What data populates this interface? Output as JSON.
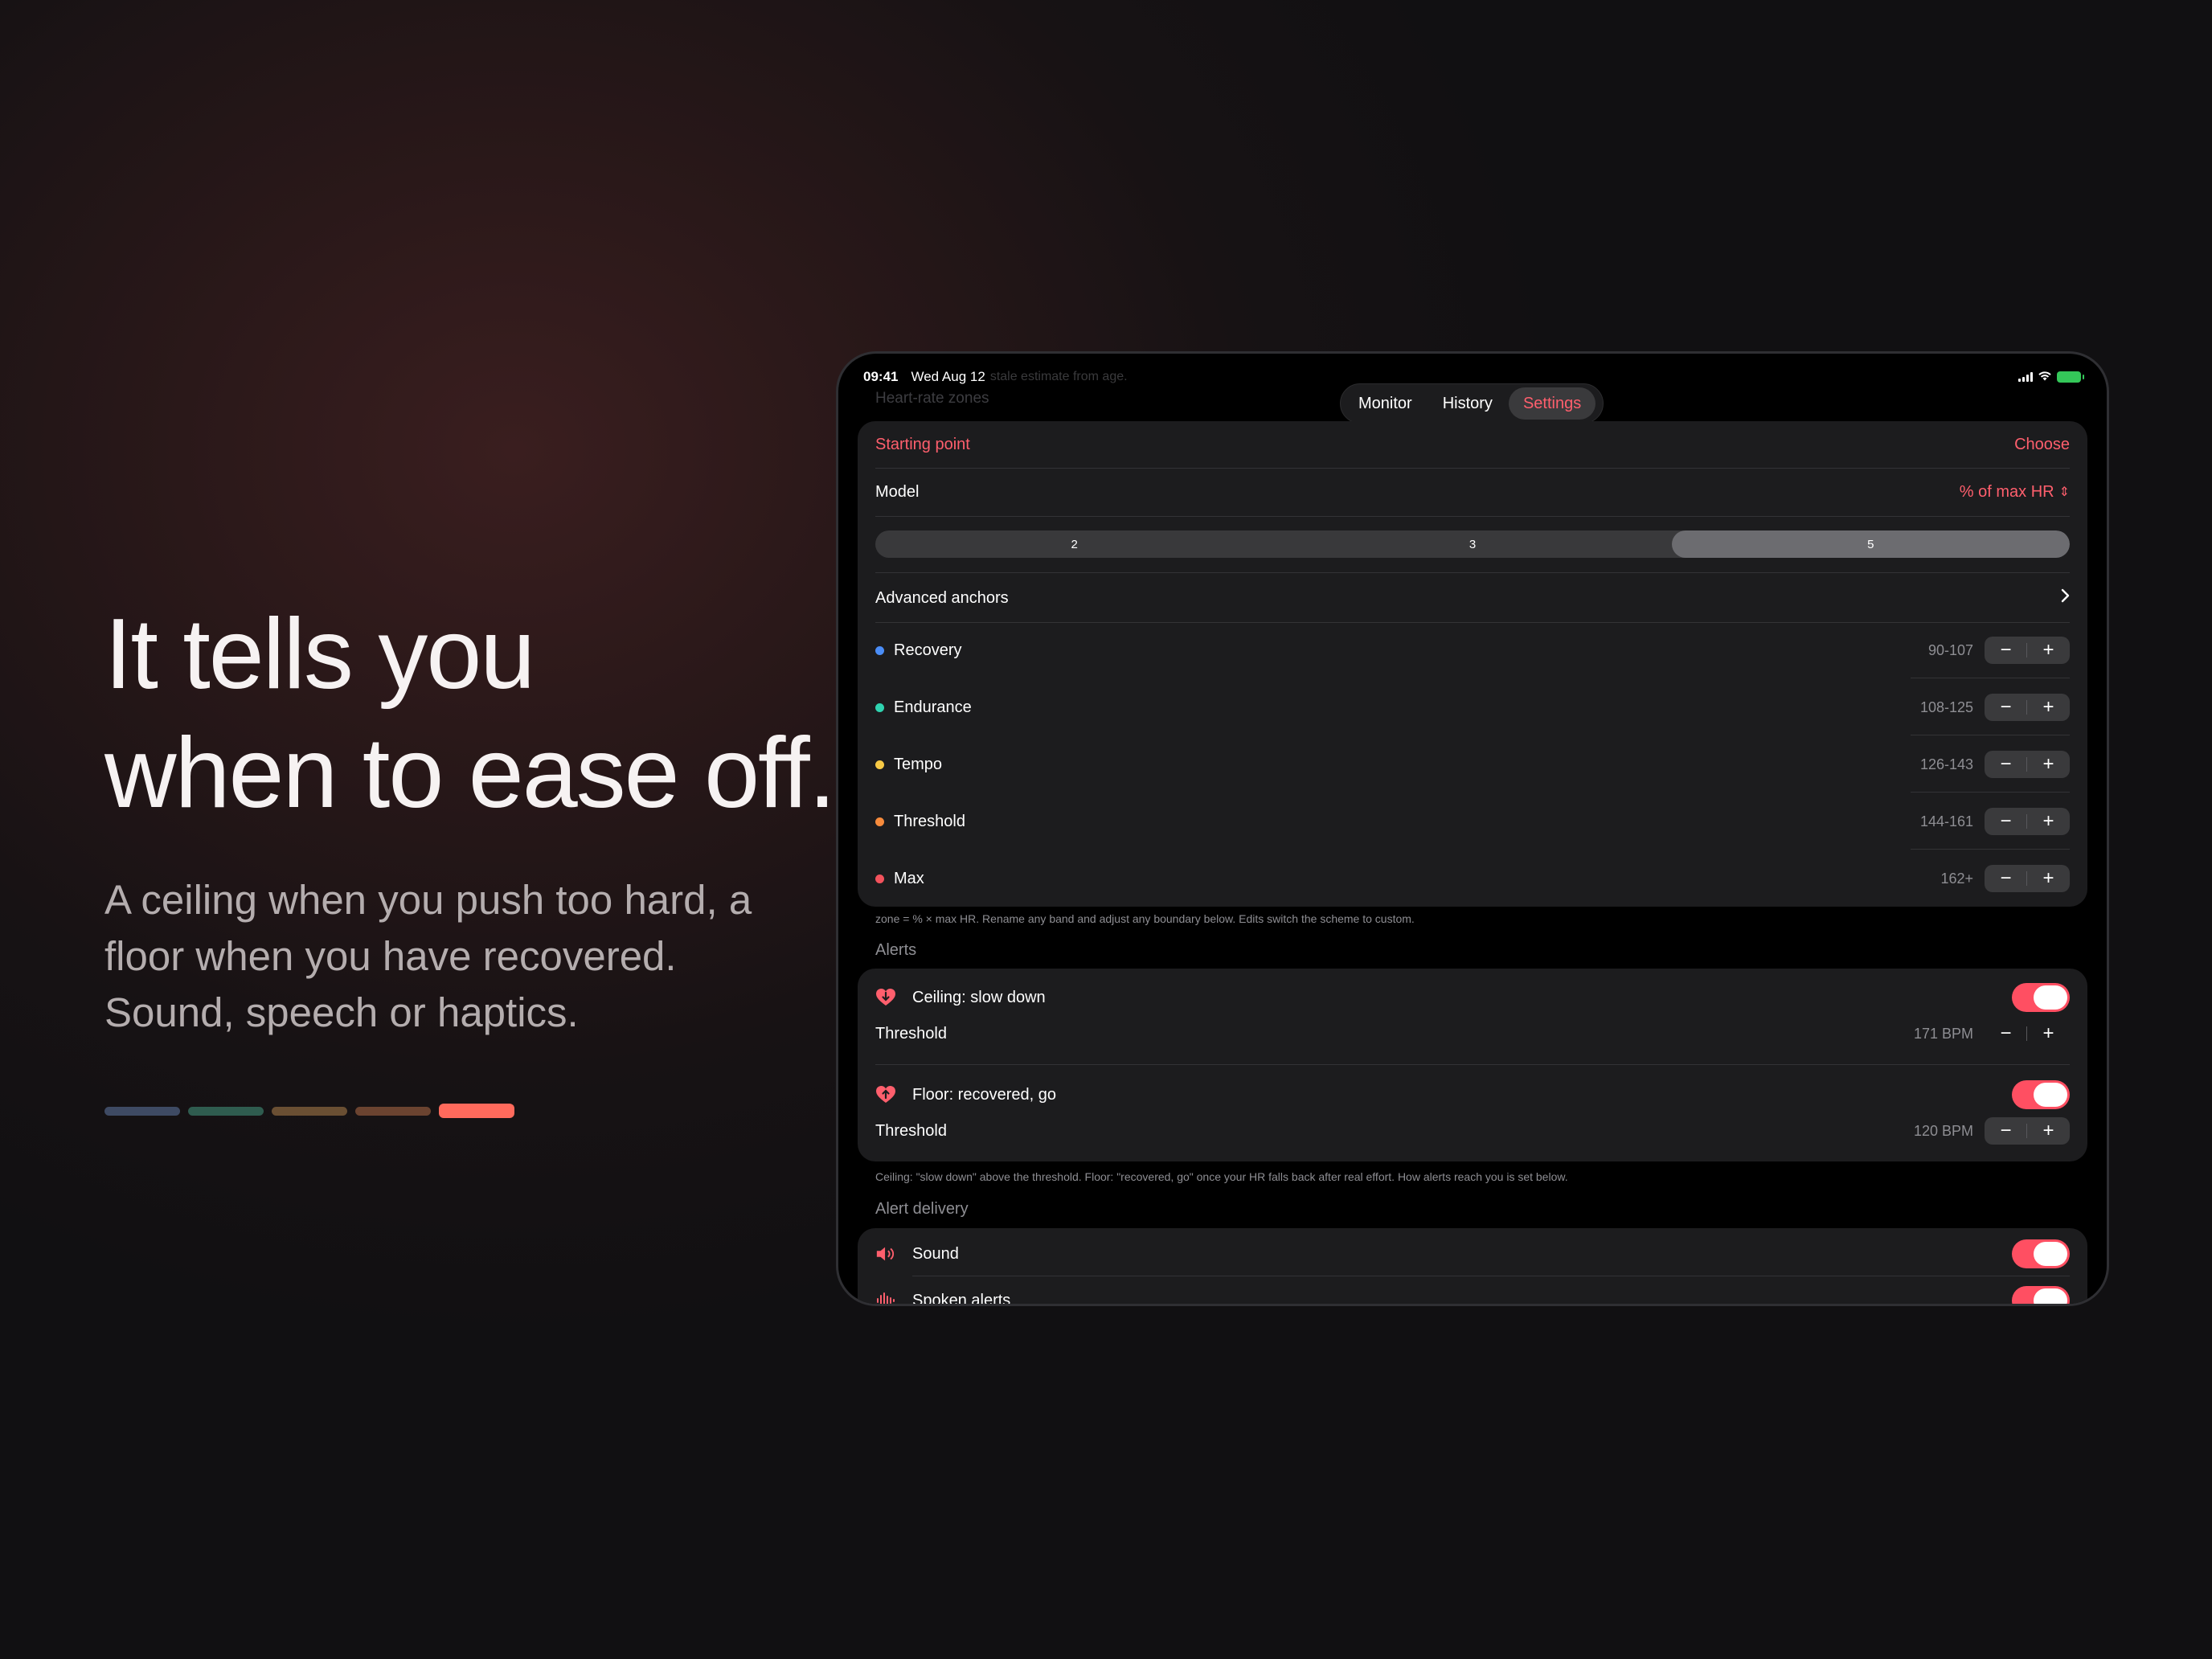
{
  "headline": {
    "line1": "It tells you",
    "line2": "when to ease off."
  },
  "subtext": {
    "line1": "A ceiling when you push too hard, a",
    "line2": "floor when you have recovered.",
    "line3": "Sound, speech or haptics."
  },
  "color_bars": [
    "#3e4a63",
    "#2f5c4f",
    "#6a4f33",
    "#6b4330",
    "#ff6a5c"
  ],
  "status": {
    "time": "09:41",
    "date": "Wed Aug 12",
    "ghost": "stale estimate from age."
  },
  "ghost_title": "Heart-rate zones",
  "tabs": [
    {
      "label": "Monitor",
      "active": false
    },
    {
      "label": "History",
      "active": false
    },
    {
      "label": "Settings",
      "active": true
    }
  ],
  "zones_card": {
    "starting_point_label": "Starting point",
    "starting_point_action": "Choose",
    "model_label": "Model",
    "model_value": "% of max HR",
    "zone_counts": [
      "2",
      "3",
      "5"
    ],
    "zone_count_selected": "5",
    "advanced_label": "Advanced anchors",
    "zones": [
      {
        "name": "Recovery",
        "range": "90-107",
        "color": "#4a8df7"
      },
      {
        "name": "Endurance",
        "range": "108-125",
        "color": "#2fd3b0"
      },
      {
        "name": "Tempo",
        "range": "126-143",
        "color": "#f7c945"
      },
      {
        "name": "Threshold",
        "range": "144-161",
        "color": "#f78b3c"
      },
      {
        "name": "Max",
        "range": "162+",
        "color": "#f2525c"
      }
    ],
    "stepper": {
      "minus": "−",
      "plus": "+"
    }
  },
  "zones_footnote": "zone = % × max HR. Rename any band and adjust any boundary below. Edits switch the scheme to custom.",
  "alerts": {
    "title": "Alerts",
    "ceiling_label": "Ceiling: slow down",
    "ceiling_threshold_label": "Threshold",
    "ceiling_threshold_value": "171 BPM",
    "floor_label": "Floor: recovered, go",
    "floor_threshold_label": "Threshold",
    "floor_threshold_value": "120 BPM",
    "ceiling_on": true,
    "floor_on": true
  },
  "alerts_footnote": "Ceiling: \"slow down\" above the threshold. Floor: \"recovered, go\" once your HR falls back after real effort. How alerts reach you is set below.",
  "delivery": {
    "title": "Alert delivery",
    "sound_label": "Sound",
    "spoken_label": "Spoken alerts",
    "sound_on": true,
    "spoken_on": true
  },
  "colors": {
    "accent": "#ff5f6d",
    "toggle_on": "#ff4f62",
    "card": "#1c1c1e"
  }
}
